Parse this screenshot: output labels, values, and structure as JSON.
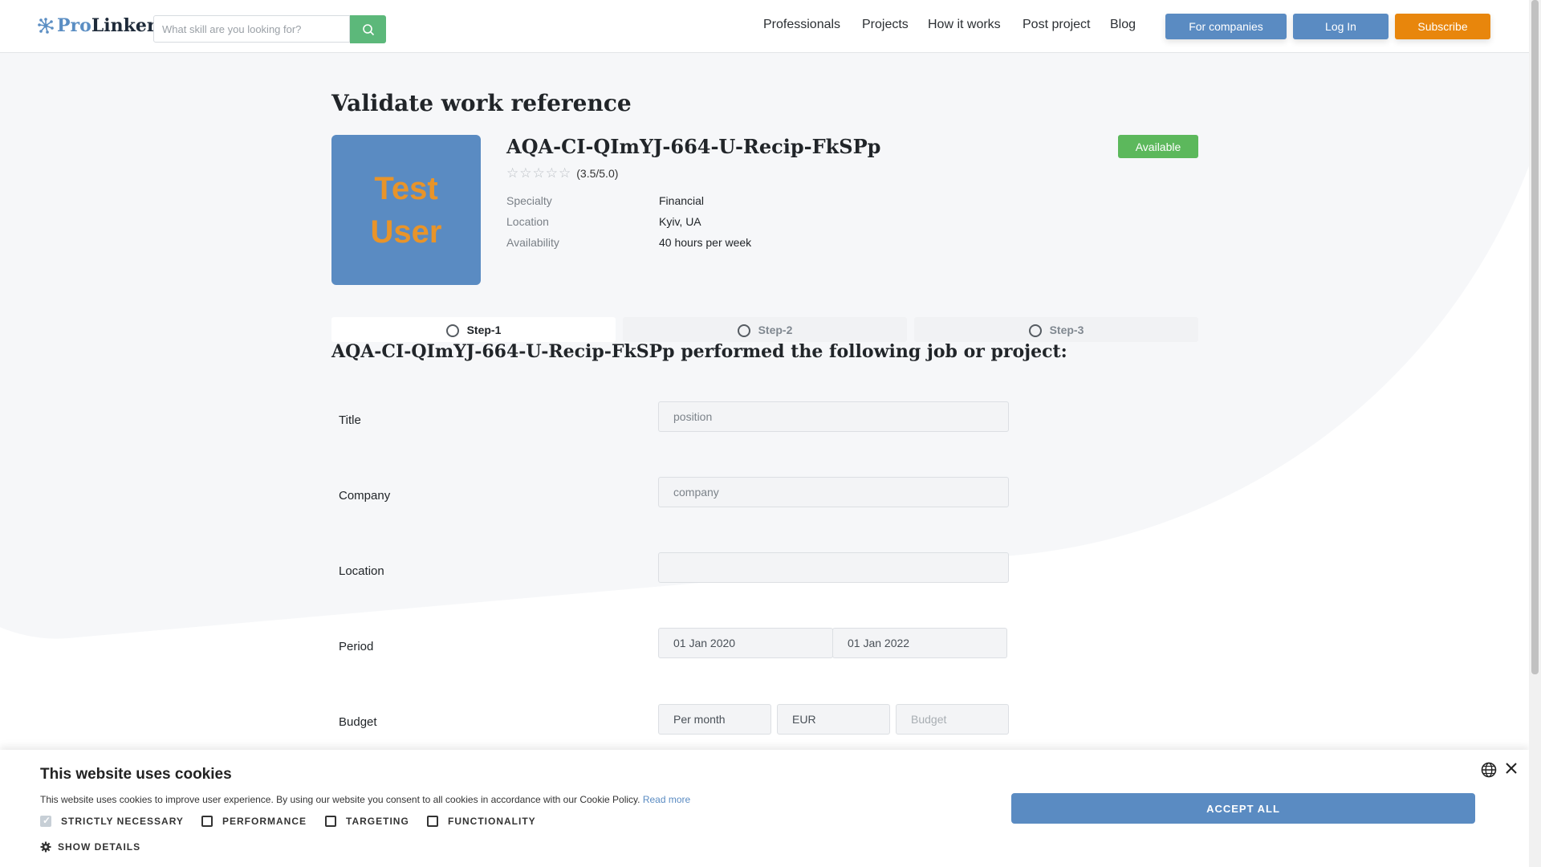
{
  "header": {
    "logo": {
      "pro": "Pro",
      "linker": "Linker"
    },
    "search_placeholder": "What skill are you looking for?",
    "nav": [
      "Professionals",
      "Projects",
      "How it works",
      "Post project",
      "Blog"
    ],
    "buttons": {
      "companies": "For companies",
      "login": "Log In",
      "subscribe": "Subscribe"
    }
  },
  "page_title": "Validate work reference",
  "profile": {
    "avatar_lines": [
      "Test",
      "User"
    ],
    "name": "AQA-CI-QImYJ-664-U-Recip-FkSPp",
    "rating": 3.5,
    "rating_text": "(3.5/5.0)",
    "info": [
      {
        "label": "Specialty",
        "value": "Financial"
      },
      {
        "label": "Location",
        "value": "Kyiv, UA"
      },
      {
        "label": "Availability",
        "value": "40 hours per week"
      }
    ],
    "status": "Available"
  },
  "steps": [
    "Step-1",
    "Step-2",
    "Step-3"
  ],
  "active_step": 0,
  "form": {
    "heading": "AQA-CI-QImYJ-664-U-Recip-FkSPp performed the following job or project:",
    "title_label": "Title",
    "title_placeholder": "position",
    "company_label": "Company",
    "company_placeholder": "company",
    "location_label": "Location",
    "location_value": "",
    "period_label": "Period",
    "period_from": "01 Jan 2020",
    "period_to": "01 Jan 2022",
    "budget_label": "Budget",
    "budget_period": "Per month",
    "budget_currency": "EUR",
    "budget_placeholder": "Budget"
  },
  "cookie": {
    "title": "This website uses cookies",
    "text": "This website uses cookies to improve user experience. By using our website you consent to all cookies in accordance with our Cookie Policy.",
    "read_more": "Read more",
    "options": [
      {
        "label": "STRICTLY NECESSARY",
        "checked": true
      },
      {
        "label": "PERFORMANCE",
        "checked": false
      },
      {
        "label": "TARGETING",
        "checked": false
      },
      {
        "label": "FUNCTIONALITY",
        "checked": false
      }
    ],
    "show_details": "SHOW DETAILS",
    "accept": "ACCEPT ALL"
  },
  "colors": {
    "brand_blue": "#5a8bc2",
    "green": "#5cb87a",
    "orange": "#e8860c",
    "badge_green": "#5cb85c"
  }
}
